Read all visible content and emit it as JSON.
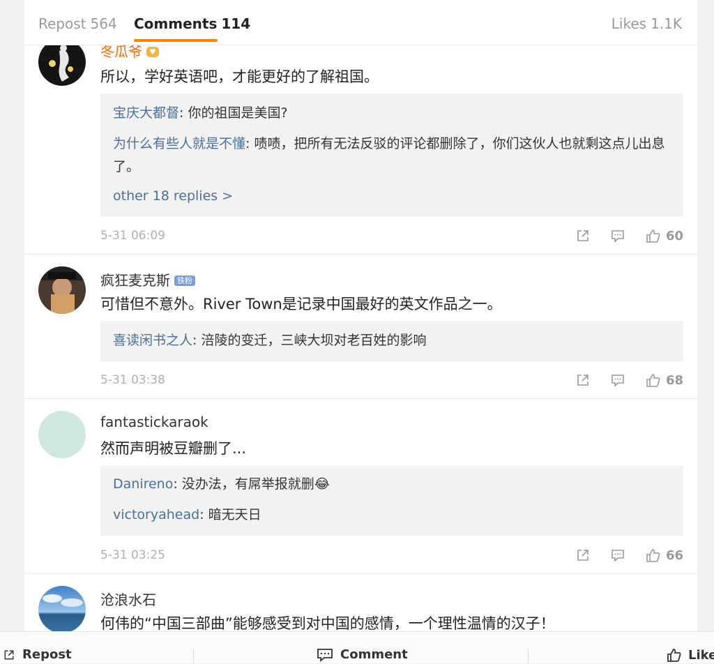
{
  "tabs": {
    "repost": {
      "label": "Repost",
      "count": "564"
    },
    "comments": {
      "label": "Comments",
      "count": "114"
    },
    "likes": {
      "label": "Likes",
      "count": "1.1K"
    }
  },
  "comments": [
    {
      "username": "冬瓜爷",
      "text": "所以，学好英语吧，才能更好的了解祖国。",
      "replies": [
        {
          "name": "宝庆大都督",
          "text": ": 你的祖国是美国?"
        },
        {
          "name": "为什么有些人就是不懂",
          "text": ": 啧啧，把所有无法反驳的评论都删除了，你们这伙人也就剩这点儿出息了。"
        }
      ],
      "more_replies": "other 18 replies >",
      "time": "5-31 06:09",
      "likes": "60"
    },
    {
      "username": "疯狂麦克斯",
      "badge": "铁粉",
      "text": "可惜但不意外。River Town是记录中国最好的英文作品之一。",
      "replies": [
        {
          "name": "喜读闲书之人",
          "text": ": 涪陵的变迁，三峡大坝对老百姓的影响"
        }
      ],
      "time": "5-31 03:38",
      "likes": "68"
    },
    {
      "username": "fantastickaraok",
      "text": "然而声明被豆瓣删了...",
      "replies": [
        {
          "name": "Danireno",
          "text": ": 没办法，有屌举报就删😂"
        },
        {
          "name": "victoryahead",
          "text": ": 暗无天日"
        }
      ],
      "time": "5-31 03:25",
      "likes": "66"
    },
    {
      "username": "沧浪水石",
      "text": "何伟的“中国三部曲”能够感受到对中国的感情，一个理性温情的汉子！"
    }
  ],
  "bottom_bar": {
    "repost": "Repost",
    "comment": "Comment",
    "like": "Like"
  },
  "colors": {
    "accent": "#ff8200",
    "link": "#4a6f9c",
    "muted": "#b0b0b0"
  }
}
